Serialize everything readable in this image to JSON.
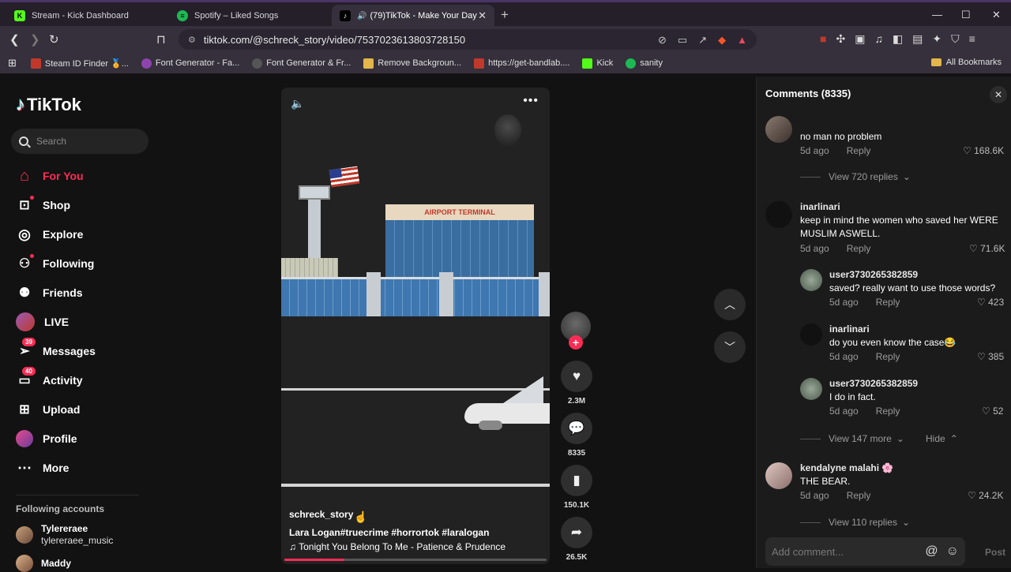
{
  "browser": {
    "tabs": [
      {
        "title": "Stream - Kick Dashboard",
        "fav": "K",
        "favcolor": "#53fc18"
      },
      {
        "title": "Spotify – Liked Songs",
        "fav": "●",
        "favcolor": "#1db954"
      },
      {
        "title": "(79)TikTok - Make Your Day",
        "fav": "♪",
        "favcolor": "#000000"
      }
    ],
    "url": "tiktok.com/@schreck_story/video/7537023613803728150",
    "bookmarks": [
      {
        "label": "Steam ID Finder 🏅...",
        "color": "#c0392b"
      },
      {
        "label": "Font Generator - Fa...",
        "color": "#8e44ad"
      },
      {
        "label": "Font Generator & Fr...",
        "color": "#333333"
      },
      {
        "label": "Remove Backgroun...",
        "color": "#e3b54a"
      },
      {
        "label": "https://get-bandlab....",
        "color": "#c0392b"
      },
      {
        "label": "Kick",
        "color": "#53fc18"
      },
      {
        "label": "sanity",
        "color": "#1db954"
      }
    ],
    "all_bookmarks": "All Bookmarks"
  },
  "sidebar": {
    "logo": "TikTok",
    "search_placeholder": "Search",
    "nav": [
      {
        "label": "For You",
        "icon": "home-icon",
        "glyph": "⌂"
      },
      {
        "label": "Shop",
        "icon": "shop-icon",
        "glyph": "🛍"
      },
      {
        "label": "Explore",
        "icon": "compass-icon",
        "glyph": "◎"
      },
      {
        "label": "Following",
        "icon": "following-icon",
        "glyph": "👤"
      },
      {
        "label": "Friends",
        "icon": "friends-icon",
        "glyph": "👥"
      },
      {
        "label": "LIVE",
        "icon": "live-icon",
        "glyph": "●"
      },
      {
        "label": "Messages",
        "icon": "messages-icon",
        "glyph": "✈",
        "badge": "39"
      },
      {
        "label": "Activity",
        "icon": "activity-icon",
        "glyph": "▭",
        "badge": "40"
      },
      {
        "label": "Upload",
        "icon": "upload-icon",
        "glyph": "⊞"
      },
      {
        "label": "Profile",
        "icon": "profile-icon",
        "glyph": "●"
      },
      {
        "label": "More",
        "icon": "more-icon",
        "glyph": "⋯"
      }
    ],
    "following_heading": "Following accounts",
    "following": [
      {
        "name": "Tylereraee",
        "username": "tylereraee_music"
      },
      {
        "name": "Maddy",
        "username": ""
      }
    ]
  },
  "video": {
    "sign": "AIRPORT TERMINAL",
    "author": "schreck_story",
    "description": "Lara Logan#truecrime #horrortok #laralogan",
    "music": "♫  Tonight You Belong To Me - Patience & Prudence",
    "progress": 0.23,
    "likes": "2.3M",
    "comments": "8335",
    "saves": "150.1K",
    "shares": "26.5K"
  },
  "comments": {
    "header": "Comments (8335)",
    "input_placeholder": "Add comment...",
    "post_label": "Post",
    "reply_label": "Reply",
    "items": [
      {
        "name": "",
        "text": "no man no problem",
        "time": "5d ago",
        "likes": "168.6K"
      },
      {
        "name": "inarlinari",
        "text": "keep in mind the women who saved her WERE MUSLIM ASWELL.",
        "time": "5d ago",
        "likes": "71.6K"
      },
      {
        "name": "user3730265382859",
        "text": "saved? really want to use those words?",
        "time": "5d ago",
        "likes": "423"
      },
      {
        "name": "inarlinari",
        "text": "do you even know the case😂",
        "time": "5d ago",
        "likes": "385"
      },
      {
        "name": "user3730265382859",
        "text": "I do in fact.",
        "time": "5d ago",
        "likes": "52"
      },
      {
        "name": "kendalyne malahi 🌸",
        "text": "THE BEAR.",
        "time": "5d ago",
        "likes": "24.2K"
      }
    ],
    "view_replies_1": "View 720 replies",
    "view_more": "View 147 more",
    "hide": "Hide",
    "view_replies_2": "View 110 replies"
  }
}
